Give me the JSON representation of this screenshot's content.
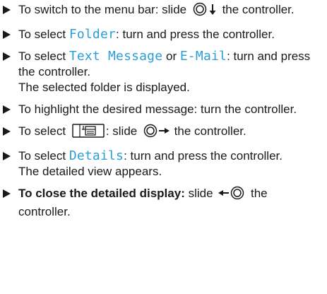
{
  "steps": [
    {
      "pre": "To switch to the menu bar: slide ",
      "post": " the controller.",
      "icon": "controller-slide-down-icon"
    },
    {
      "pre": "To select ",
      "display": "Folder",
      "post": ": turn and press the controller."
    },
    {
      "pre": "To select ",
      "display_a": "Text Message",
      "mid": " or ",
      "display_b": "E-Mail",
      "post": ": turn and press the controller.",
      "result": "The selected folder is displayed."
    },
    {
      "text": "To highlight the desired message: turn the controller."
    },
    {
      "pre": "To select ",
      "mid": ": slide ",
      "post": " the controller.",
      "icon_menu": "menu-symbol-icon",
      "icon": "controller-slide-right-icon"
    },
    {
      "pre": "To select ",
      "display": "Details",
      "post": ": turn and press the controller.",
      "result": "The detailed view appears."
    },
    {
      "bold": "To close the detailed display:",
      "mid": " slide ",
      "post": " the controller.",
      "icon": "controller-slide-left-icon"
    }
  ],
  "colors": {
    "display_text": "#2a9fd8",
    "body_text": "#1a1a1a"
  }
}
